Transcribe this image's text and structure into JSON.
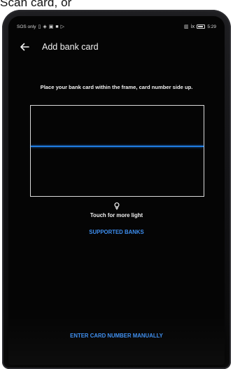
{
  "caption": {
    "text": "Scan card, or"
  },
  "status_bar": {
    "carrier": "SOS only",
    "time": "5:29",
    "left_icons": [
      "sim-icon",
      "wifi-icon",
      "gallery-icon",
      "notification-icon",
      "play-icon"
    ],
    "right_icons": [
      "signal-icon",
      "mute-icon",
      "battery-icon"
    ]
  },
  "app_bar": {
    "title": "Add bank card",
    "back_icon": "back-arrow-icon"
  },
  "scanner": {
    "instruction": "Place your bank card within the frame, card number side up.",
    "frame_color": "#d9d9d9",
    "scan_line_color": "#1e7be0"
  },
  "flash": {
    "icon": "lightbulb-icon",
    "label": "Touch for more light"
  },
  "links": {
    "supported_banks": "SUPPORTED BANKS",
    "enter_manually": "ENTER CARD NUMBER MANUALLY",
    "accent_color": "#3d8eef"
  }
}
